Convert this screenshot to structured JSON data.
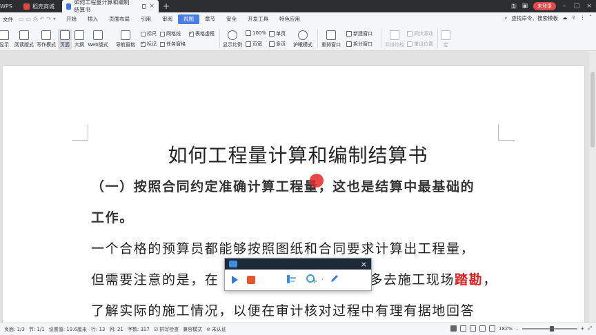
{
  "titlebar": {
    "tabs": [
      {
        "label": "WPS",
        "color": "#3b6fd4"
      },
      {
        "label": "稻壳商城",
        "color": "#e04c3c"
      },
      {
        "label": "如何工程量计算和编制结算书",
        "color": "#3b78e7"
      }
    ],
    "badge": "1",
    "login": "未登录"
  },
  "menubar": {
    "file": "文件",
    "items": [
      "开始",
      "插入",
      "页面布局",
      "引用",
      "审阅",
      "视图",
      "章节",
      "安全",
      "开发工具",
      "特色应用"
    ],
    "active": "视图",
    "search": "查找命令、搜索模板"
  },
  "ribbon": {
    "buttons": [
      "显示",
      "阅读版式",
      "写作模式",
      "页面",
      "大纲",
      "Web版式",
      "导航窗格",
      "显示比例",
      "100%",
      "页宽",
      "单页",
      "多页",
      "护眼模式",
      "重排窗口",
      "新建窗口",
      "拆分窗口",
      "并排比较",
      "同步滚动",
      "重设位置",
      "宏"
    ],
    "checks": [
      {
        "label": "标尺",
        "checked": false
      },
      {
        "label": "网格线",
        "checked": false
      },
      {
        "label": "表格虚框",
        "checked": true
      },
      {
        "label": "标记",
        "checked": true
      },
      {
        "label": "任务窗格",
        "checked": false
      }
    ]
  },
  "document": {
    "title": "如何工程量计算和编制结算书",
    "heading_line1": "（一）按照合同约定准确计算工程量，这也是结算中最基础的",
    "heading_line2": "工作。",
    "line3": "一个合格的预算员都能够按照图纸和合同要求计算出工程量，",
    "line4_a": "但需要注意的是，在",
    "line4_b": "多去施工现场",
    "line4_red": "踏勘",
    "line4_end": "，",
    "line5": "了解实际的施工情况，以便在审计核对过程中有理有据地回答"
  },
  "statusbar": {
    "page": "页面: 1/3",
    "section": "节: 1/1",
    "setting": "设置值: 19.6厘米",
    "row": "行: 13",
    "col": "列: 21",
    "words": "字数: 327",
    "spell": "拼写检查",
    "compat": "兼容模式",
    "cert": "未认证",
    "zoom": "182%"
  }
}
